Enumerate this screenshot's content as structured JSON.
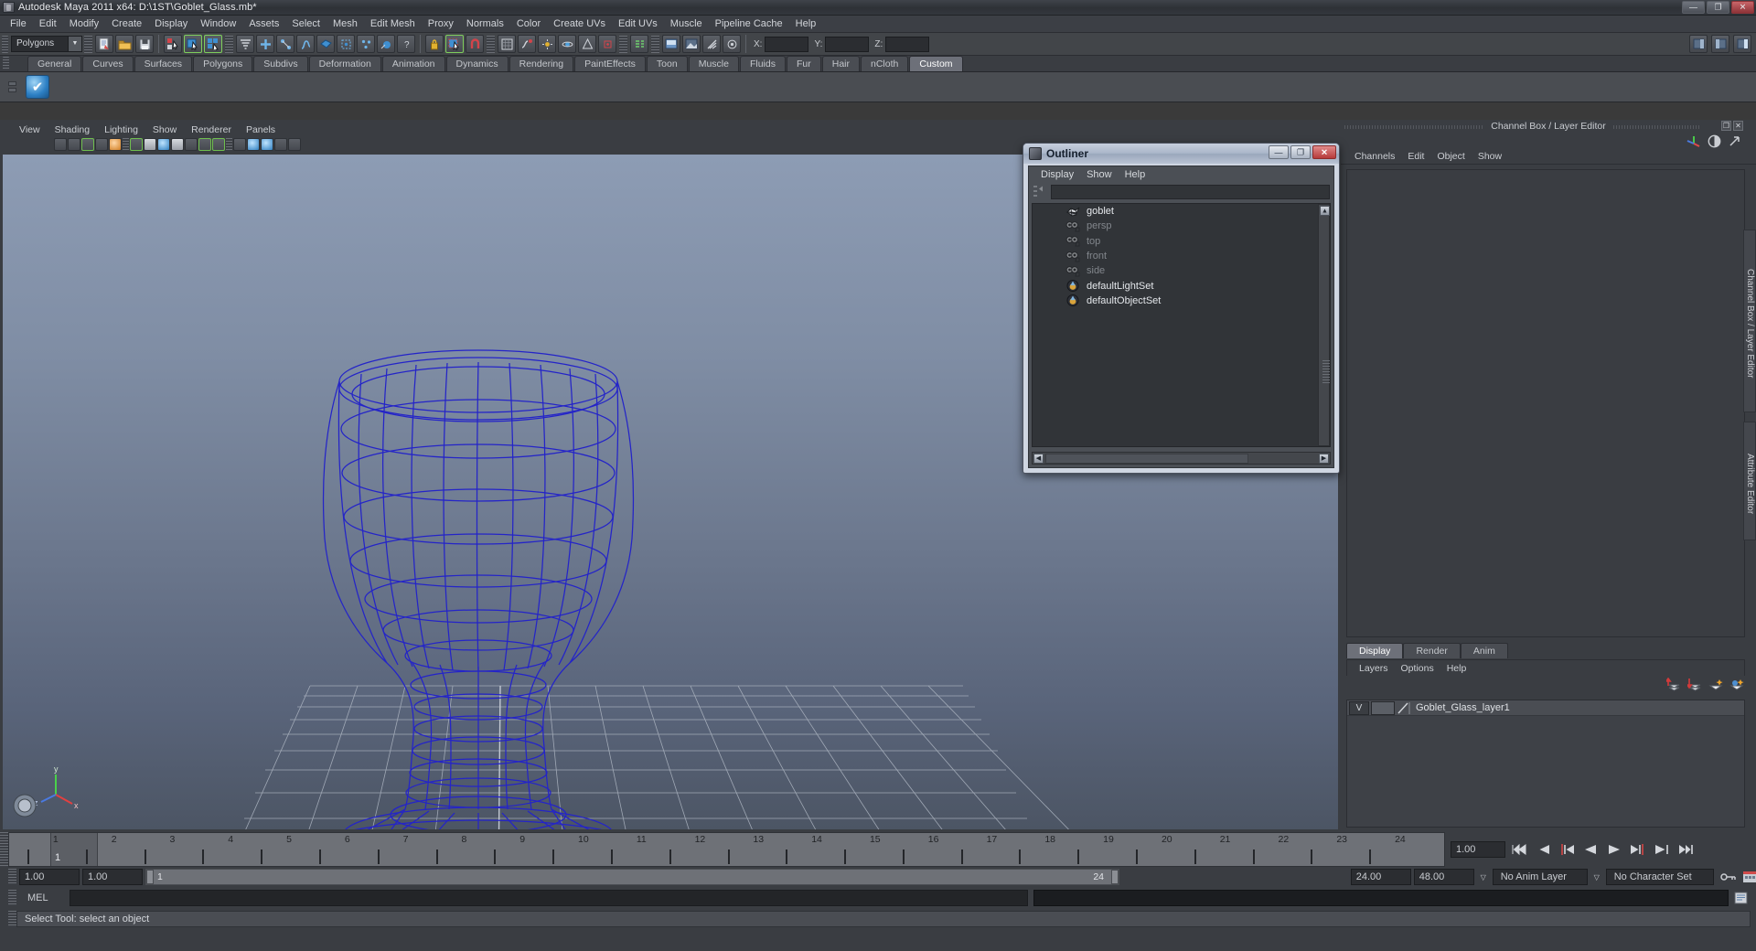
{
  "window": {
    "title": "Autodesk Maya 2011 x64: D:\\1ST\\Goblet_Glass.mb*",
    "app_icon": "maya-icon",
    "buttons": {
      "minimize": "—",
      "maximize": "❐",
      "close": "✕"
    }
  },
  "menubar": {
    "items": [
      "File",
      "Edit",
      "Modify",
      "Create",
      "Display",
      "Window",
      "Assets",
      "Select",
      "Mesh",
      "Edit Mesh",
      "Proxy",
      "Normals",
      "Color",
      "Create UVs",
      "Edit UVs",
      "Muscle",
      "Pipeline Cache",
      "Help"
    ]
  },
  "statusline": {
    "mode_selector": {
      "value": "Polygons",
      "icon": "chevron-down-icon"
    },
    "coord_labels": {
      "x": "X:",
      "y": "Y:",
      "z": "Z:"
    },
    "coord_values": {
      "x": "",
      "y": "",
      "z": ""
    }
  },
  "shelf": {
    "tabs": [
      "General",
      "Curves",
      "Surfaces",
      "Polygons",
      "Subdivs",
      "Deformation",
      "Animation",
      "Dynamics",
      "Rendering",
      "PaintEffects",
      "Toon",
      "Muscle",
      "Fluids",
      "Fur",
      "Hair",
      "nCloth",
      "Custom"
    ],
    "active_tab": "Custom"
  },
  "viewport": {
    "menubar": [
      "View",
      "Shading",
      "Lighting",
      "Show",
      "Renderer",
      "Panels"
    ],
    "model_name": "goblet",
    "wireframe_color": "#2424c8",
    "background_top": "#8d9cb4",
    "background_bottom": "#4e5766",
    "axis": {
      "x": "x",
      "y": "y",
      "z": "z"
    }
  },
  "outliner": {
    "title": "Outliner",
    "menubar": [
      "Display",
      "Show",
      "Help"
    ],
    "search_value": "",
    "items": [
      {
        "label": "goblet",
        "icon": "mesh-icon",
        "dimmed": false
      },
      {
        "label": "persp",
        "icon": "camera-icon",
        "dimmed": true
      },
      {
        "label": "top",
        "icon": "camera-icon",
        "dimmed": true
      },
      {
        "label": "front",
        "icon": "camera-icon",
        "dimmed": true
      },
      {
        "label": "side",
        "icon": "camera-icon",
        "dimmed": true
      },
      {
        "label": "defaultLightSet",
        "icon": "set-icon",
        "dimmed": false
      },
      {
        "label": "defaultObjectSet",
        "icon": "set-icon",
        "dimmed": false
      }
    ],
    "window_buttons": {
      "minimize": "—",
      "maximize": "❐",
      "close": "✕"
    }
  },
  "channel_box": {
    "title": "Channel Box / Layer Editor",
    "menubar": [
      "Channels",
      "Edit",
      "Object",
      "Show"
    ],
    "dock_labels": {
      "primary": "Channel Box / Layer Editor",
      "secondary": "Attribute Editor"
    },
    "window_buttons": {
      "undock": "❐",
      "close": "✕"
    }
  },
  "layer_editor": {
    "tabs": [
      "Display",
      "Render",
      "Anim"
    ],
    "active_tab": "Display",
    "menubar": [
      "Layers",
      "Options",
      "Help"
    ],
    "layers": [
      {
        "visibility": "V",
        "shading": "",
        "name": "Goblet_Glass_layer1"
      }
    ]
  },
  "timeline": {
    "ticks": [
      "1",
      "2",
      "3",
      "4",
      "5",
      "6",
      "7",
      "8",
      "9",
      "10",
      "11",
      "12",
      "13",
      "14",
      "15",
      "16",
      "17",
      "18",
      "19",
      "20",
      "21",
      "22",
      "23",
      "24"
    ],
    "current_frame": "1",
    "current_frame_field": "1.00",
    "playback_buttons": [
      "go-to-start",
      "step-back-keyframe",
      "step-back-frame",
      "play-backwards",
      "play-forwards",
      "step-forward-frame",
      "step-forward-keyframe",
      "go-to-end"
    ]
  },
  "range_slider": {
    "start_field": "1.00",
    "end_field": "1.00",
    "range_start_label": "1",
    "range_end_label": "24",
    "playback_start": "24.00",
    "playback_end": "48.00",
    "anim_layer": "No Anim Layer",
    "character_set": "No Character Set"
  },
  "command_line": {
    "label": "MEL",
    "input_value": ""
  },
  "status_bar": {
    "message": "Select Tool: select an object"
  }
}
